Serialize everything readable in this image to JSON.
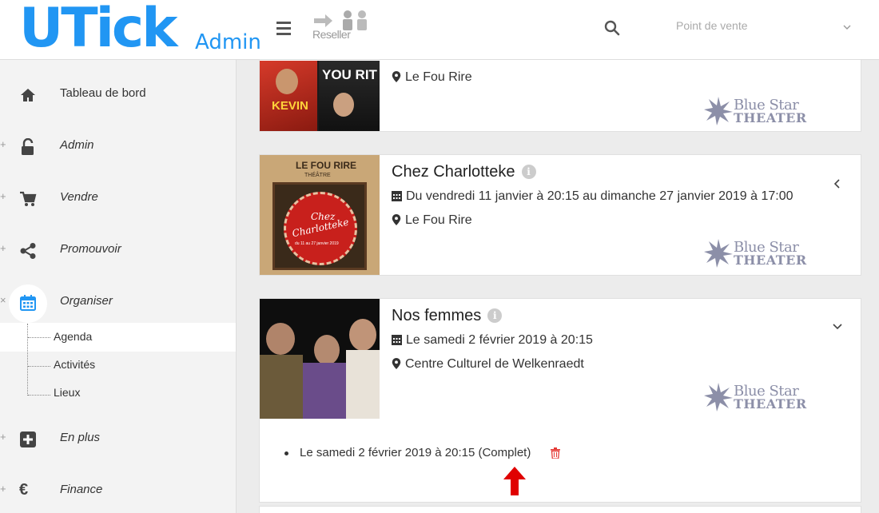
{
  "header": {
    "logo_main": "UTick",
    "logo_sub": "Admin",
    "reseller_label": "Reseller",
    "pos_placeholder": "Point de vente"
  },
  "sidebar": {
    "items": [
      {
        "label": "Tableau de bord",
        "icon": "home-icon",
        "expander": ""
      },
      {
        "label": "Admin",
        "icon": "unlock-icon",
        "expander": "+"
      },
      {
        "label": "Vendre",
        "icon": "cart-icon",
        "expander": "+"
      },
      {
        "label": "Promouvoir",
        "icon": "share-icon",
        "expander": "+"
      },
      {
        "label": "Organiser",
        "icon": "calendar-icon",
        "expander": "×"
      },
      {
        "label": "En plus",
        "icon": "plus-square-icon",
        "expander": "+"
      },
      {
        "label": "Finance",
        "icon": "euro-icon",
        "expander": "+"
      }
    ],
    "subitems": [
      {
        "label": "Agenda",
        "active": true
      },
      {
        "label": "Activités",
        "active": false
      },
      {
        "label": "Lieux",
        "active": false
      }
    ]
  },
  "events": [
    {
      "title": "",
      "dates": "",
      "venue": "Le Fou Rire",
      "thumb_text": [
        "KEVIN",
        "YOU RIT"
      ]
    },
    {
      "title": "Chez Charlotteke",
      "dates": "Du vendredi 11 janvier à 20:15 au dimanche 27 janvier 2019 à 17:00",
      "venue": "Le Fou Rire",
      "thumb_text": [
        "LE FOU RIRE",
        "THÉÂTRE",
        "Chez",
        "Charlotteke",
        "du 11 au 27 janvier 2019"
      ]
    },
    {
      "title": "Nos femmes",
      "dates": "Le samedi 2 février 2019 à 20:15",
      "venue": "Centre Culturel de Welkenraedt",
      "sessions": [
        "Le samedi 2 février 2019 à 20:15 (Complet)"
      ]
    }
  ],
  "organizer_logo": {
    "line1": "Blue Star",
    "line2": "THEATER"
  },
  "colors": {
    "brand": "#2196f3",
    "organizer": "#8c8fa8",
    "danger": "#e53935",
    "arrow": "#e00000"
  }
}
